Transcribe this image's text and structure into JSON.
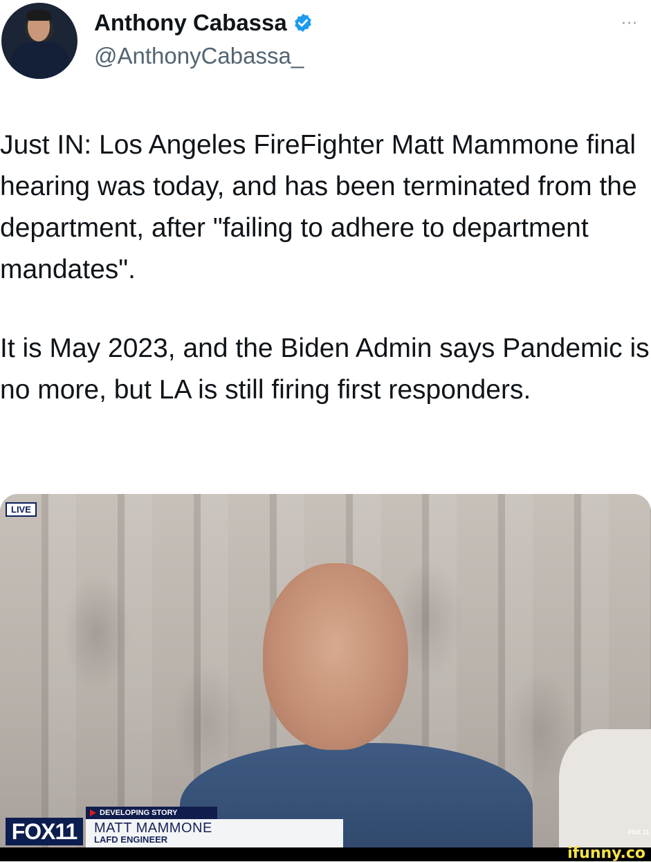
{
  "header": {
    "display_name": "Anthony Cabassa",
    "handle": "@AnthonyCabassa_",
    "more_label": "···",
    "verified_icon": "verified-badge",
    "verified_color": "#1d9bf0"
  },
  "tweet": {
    "paragraph1": "Just IN: Los Angeles FireFighter Matt Mammone final hearing was today, and has been terminated from the department, after \"failing to adhere to department mandates\".",
    "paragraph2": "It is May 2023, and the Biden Admin says Pandemic is no more, but LA is still firing first responders."
  },
  "media": {
    "live_label": "LIVE",
    "developing_label": "DEVELOPING STORY",
    "lower_third_name": "MATT MAMMONE",
    "lower_third_title": "LAFD ENGINEER",
    "network_logo": "FOX11",
    "network_bug": "FOX 11"
  },
  "watermark": {
    "text": "ifunny.co"
  }
}
